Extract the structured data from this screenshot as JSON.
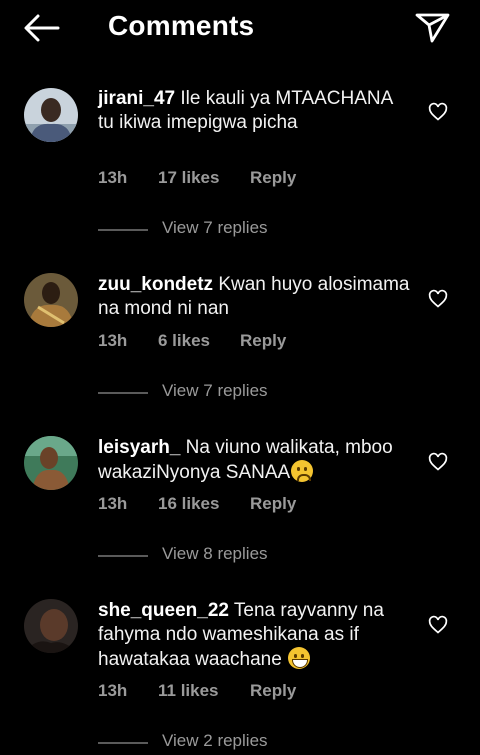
{
  "header": {
    "title": "Comments",
    "back_icon": "arrow-left-icon",
    "send_icon": "send-icon"
  },
  "comments": [
    {
      "username": "jirani_47",
      "text": " Ile kauli ya MTAACHANA tu ikiwa imepigwa picha",
      "time": "13h",
      "likes": "17 likes",
      "reply": "Reply",
      "view_replies": "View 7 replies",
      "emoji": ""
    },
    {
      "username": "zuu_kondetz",
      "text": " Kwan huyo alosimama na mond ni nan",
      "time": "13h",
      "likes": "6 likes",
      "reply": "Reply",
      "view_replies": "View 7 replies",
      "emoji": ""
    },
    {
      "username": "leisyarh_",
      "text": " Na viuno walikata, mboo wakaziNyonya SANAA",
      "time": "13h",
      "likes": "16 likes",
      "reply": "Reply",
      "view_replies": "View 8 replies",
      "emoji": "sad-face-emoji"
    },
    {
      "username": "she_queen_22",
      "text": " Tena rayvanny na fahyma ndo wameshikana as if hawatakaa waachane ",
      "time": "13h",
      "likes": "11 likes",
      "reply": "Reply",
      "view_replies": "View 2 replies",
      "emoji": "grinning-face-emoji"
    }
  ],
  "colors": {
    "background": "#000000",
    "text": "#ffffff",
    "secondary": "#9a9a9a"
  }
}
